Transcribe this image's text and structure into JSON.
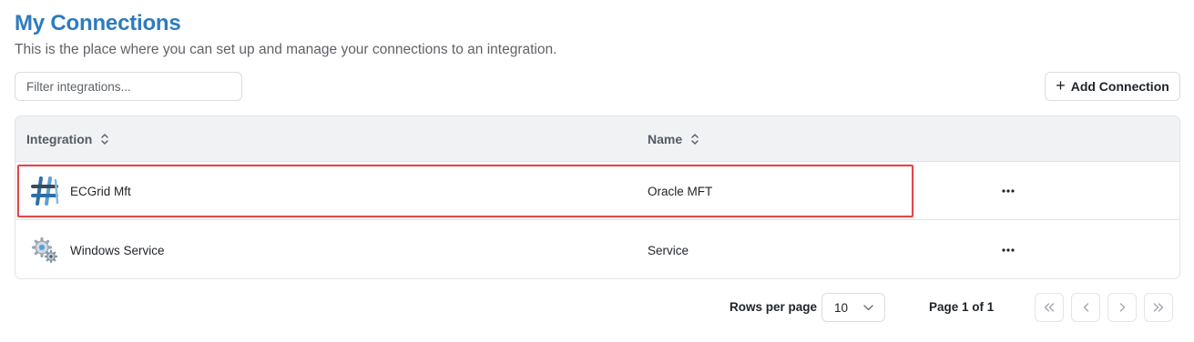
{
  "page": {
    "title": "My Connections",
    "subtitle": "This is the place where you can set up and manage your connections to an integration."
  },
  "filter": {
    "placeholder": "Filter integrations..."
  },
  "toolbar": {
    "add_label": "Add Connection"
  },
  "table": {
    "columns": [
      {
        "label": "Integration"
      },
      {
        "label": "Name"
      }
    ],
    "rows": [
      {
        "integration": "ECGrid Mft",
        "name": "Oracle MFT",
        "icon": "ecgrid-logo-icon",
        "highlighted": true
      },
      {
        "integration": "Windows Service",
        "name": "Service",
        "icon": "windows-service-gear-icon",
        "highlighted": false
      }
    ]
  },
  "pagination": {
    "rows_per_page_label": "Rows per page",
    "rows_per_page_value": "10",
    "page_info": "Page 1 of 1"
  },
  "colors": {
    "title": "#2e7bbf",
    "highlight_border": "#e0474c",
    "header_bg": "#f1f2f4"
  }
}
